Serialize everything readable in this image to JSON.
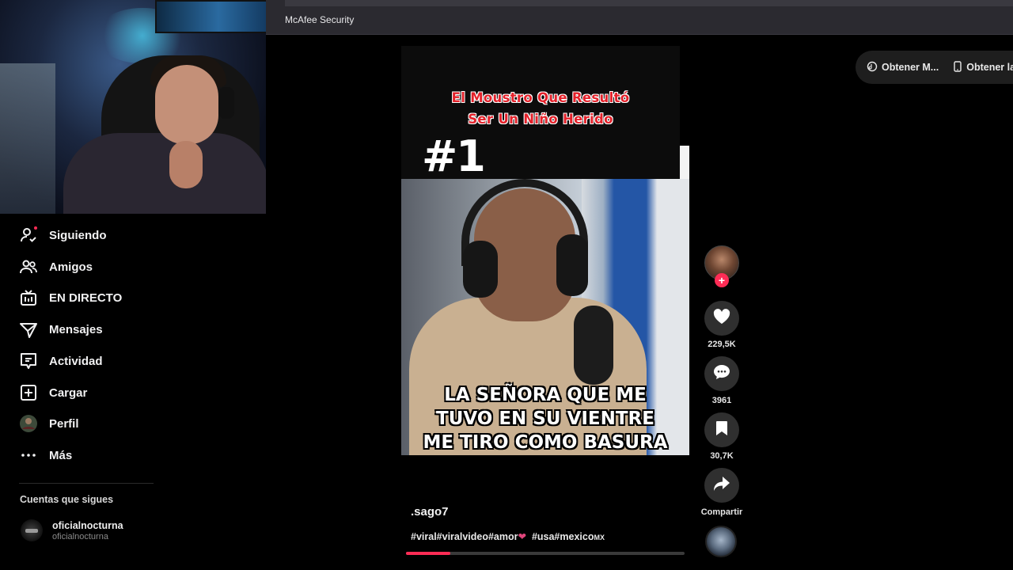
{
  "browser": {
    "bookmark": "McAfee Security"
  },
  "sidebar": {
    "items": [
      {
        "label": "Siguiendo",
        "icon": "following-icon"
      },
      {
        "label": "Amigos",
        "icon": "friends-icon"
      },
      {
        "label": "EN DIRECTO",
        "icon": "live-icon"
      },
      {
        "label": "Mensajes",
        "icon": "messages-icon"
      },
      {
        "label": "Actividad",
        "icon": "activity-icon"
      },
      {
        "label": "Cargar",
        "icon": "upload-icon"
      },
      {
        "label": "Perfil",
        "icon": "profile-avatar-icon"
      },
      {
        "label": "Más",
        "icon": "more-icon"
      }
    ],
    "following_title": "Cuentas que sigues",
    "following_account": {
      "name": "oficialnocturna",
      "handle": "oficialnocturna"
    }
  },
  "top_actions": {
    "get_app": "Obtener M...",
    "get_desktop": "Obtener la"
  },
  "video": {
    "title_line1": "El Moustro Que Resultó",
    "title_line2": "Ser Un Niño Herido",
    "episode": "#1",
    "caption_line1": "LA SEÑORA QUE ME",
    "caption_line2": "TUVO EN SU VIENTRE",
    "caption_line3": "ME TIRO COMO BASURA",
    "author": ".sago7",
    "hashtags": "#viral#viralvideo#amor",
    "hashtags2": "#usa#mexico",
    "hashtags2_suffix": "MX",
    "progress": 0.16
  },
  "stats": {
    "likes": "229,5K",
    "comments": "3961",
    "saves": "30,7K",
    "share": "Compartir"
  },
  "colors": {
    "accent": "#fe2c55",
    "title_red": "#e3212a",
    "notification_dot": "#fe2c55"
  }
}
